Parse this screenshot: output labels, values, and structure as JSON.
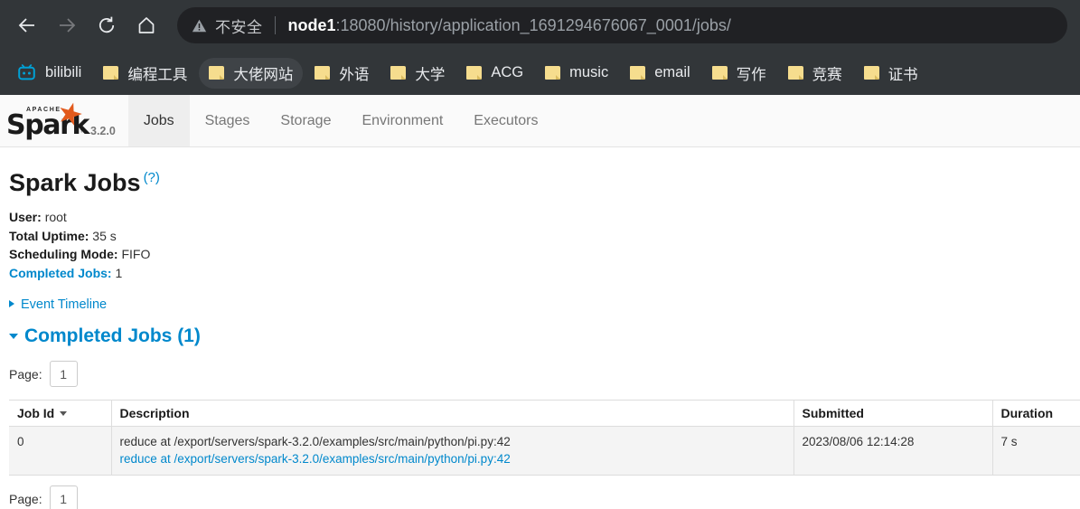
{
  "browser": {
    "back_icon": "arrow-left-icon",
    "forward_icon": "arrow-right-icon",
    "reload_icon": "reload-icon",
    "home_icon": "home-icon",
    "security_icon": "warning-triangle-icon",
    "security_label": "不安全",
    "url_host": "node1",
    "url_rest": ":18080/history/application_1691294676067_0001/jobs/",
    "bookmarks": [
      {
        "label": "bilibili",
        "icon": "bilibili-icon",
        "hovered": false
      },
      {
        "label": "编程工具",
        "icon": "folder-icon",
        "hovered": false
      },
      {
        "label": "大佬网站",
        "icon": "folder-icon",
        "hovered": true
      },
      {
        "label": "外语",
        "icon": "folder-icon",
        "hovered": false
      },
      {
        "label": "大学",
        "icon": "folder-icon",
        "hovered": false
      },
      {
        "label": "ACG",
        "icon": "folder-icon",
        "hovered": false
      },
      {
        "label": "music",
        "icon": "folder-icon",
        "hovered": false
      },
      {
        "label": "email",
        "icon": "folder-icon",
        "hovered": false
      },
      {
        "label": "写作",
        "icon": "folder-icon",
        "hovered": false
      },
      {
        "label": "竞赛",
        "icon": "folder-icon",
        "hovered": false
      },
      {
        "label": "证书",
        "icon": "folder-icon",
        "hovered": false
      }
    ]
  },
  "spark_nav": {
    "logo_apache": "APACHE",
    "logo_word": "Spark",
    "logo_tm": "™",
    "version": "3.2.0",
    "tabs": [
      {
        "label": "Jobs",
        "active": true
      },
      {
        "label": "Stages",
        "active": false
      },
      {
        "label": "Storage",
        "active": false
      },
      {
        "label": "Environment",
        "active": false
      },
      {
        "label": "Executors",
        "active": false
      }
    ]
  },
  "main": {
    "title": "Spark Jobs",
    "title_help": "(?)",
    "summary": [
      {
        "label": "User:",
        "value": "root",
        "link": false
      },
      {
        "label": "Total Uptime:",
        "value": "35 s",
        "link": false
      },
      {
        "label": "Scheduling Mode:",
        "value": "FIFO",
        "link": false
      },
      {
        "label": "Completed Jobs:",
        "value": "1",
        "link": true
      }
    ],
    "event_timeline": "Event Timeline",
    "section_title": "Completed Jobs (1)",
    "pager_label": "Page:",
    "page_value": "1",
    "table": {
      "columns": [
        "Job Id",
        "Description",
        "Submitted",
        "Duration"
      ],
      "sorted_column": "Job Id",
      "rows": [
        {
          "job_id": "0",
          "description_plain": "reduce at /export/servers/spark-3.2.0/examples/src/main/python/pi.py:42",
          "description_link": "reduce at /export/servers/spark-3.2.0/examples/src/main/python/pi.py:42",
          "submitted": "2023/08/06 12:14:28",
          "duration": "7 s"
        }
      ]
    },
    "bottom_pager_label": "Page:",
    "bottom_page_value": "1"
  },
  "colors": {
    "chrome_bg": "#323639",
    "omnibox_bg": "#202124",
    "link_blue": "#0088cc",
    "spark_orange": "#e25a1c",
    "bilibili_cyan": "#00a1d6"
  }
}
